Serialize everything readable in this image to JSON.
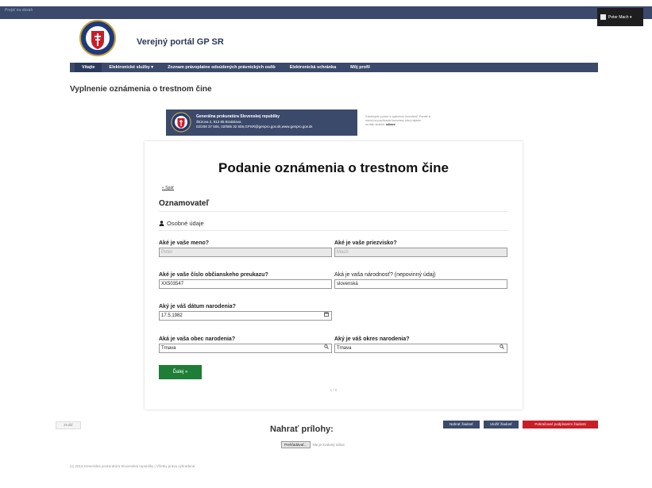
{
  "header": {
    "skip_link": "Prejsť na obsah",
    "site_title": "Verejný portál GP SR",
    "user_menu_label": "Peter Mach ▾"
  },
  "nav": {
    "items": [
      {
        "label": "Vitajte"
      },
      {
        "label": "Elektronické služby ▾"
      },
      {
        "label": "Zoznam právoplatne odsúdených právnických osôb"
      },
      {
        "label": "Elektronická schránka"
      },
      {
        "label": "Môj profil"
      }
    ]
  },
  "page": {
    "heading": "Vyplnenie oznámenia o trestnom čine"
  },
  "org": {
    "name": "Generálna prokuratúra Slovenskej republiky",
    "address": "Štúrova 2, 812 85 Bratislava",
    "contact": "02/208 37 505, 02/595 32 505,GPSR@genpro.gov.sk,www.genpro.gov.sk"
  },
  "help": {
    "line1": "Potrebujete pomoc s vyplnením formulára? Pozrite si",
    "line2": "návod na používanie formulára, ktorý nájdete",
    "line3": "na tejto stránke:",
    "link": "odkaze"
  },
  "form": {
    "title": "Podanie oznámenia o trestnom čine",
    "back_link": "« Späť",
    "section": "Oznamovateľ",
    "subsection": "Osobné údaje",
    "fields": {
      "first_name": {
        "label": "Aké je vaše meno?",
        "value": "Peter"
      },
      "last_name": {
        "label": "Aké je vaše priezvisko?",
        "value": "Mach"
      },
      "id_card": {
        "label": "Aké je vaše číslo občianskeho preukazu?",
        "value": "XX503547"
      },
      "nationality": {
        "label": "Aká je vaša národnosť? (nepovinný údaj)",
        "value": "slovenská"
      },
      "birth_date": {
        "label": "Aký je váš dátum narodenia?",
        "value": "17.5.1982"
      },
      "birth_town": {
        "label": "Aká je vaša obec narodenia?",
        "value": "Trnava"
      },
      "birth_district": {
        "label": "Aký je váš okres narodenia?",
        "value": "Trnava"
      }
    },
    "next_label": "Ďalej »",
    "pager": "1 / 6"
  },
  "bottom": {
    "cancel_label": "Zrušiť",
    "attachments_title": "Nahrať prílohy:",
    "browse_label": "Prehľadávať...",
    "no_file_label": "Nie je zvolený súbor.",
    "upload_label": "Nahrať žiadosť",
    "save_label": "Uložiť žiadosť",
    "sign_label": "Pokračovať podpísaním žiadosti"
  },
  "footer": {
    "text": "(c) 2015 Generálna prokuratúra Slovenskej republiky | Všetky práva vyhradené"
  },
  "colors": {
    "nav_bg": "#3b4a6b",
    "primary_btn": "#1e7d36",
    "danger_btn": "#c81e28"
  },
  "icons": {
    "user": "person-icon",
    "calendar": "calendar-icon",
    "search": "search-icon"
  }
}
